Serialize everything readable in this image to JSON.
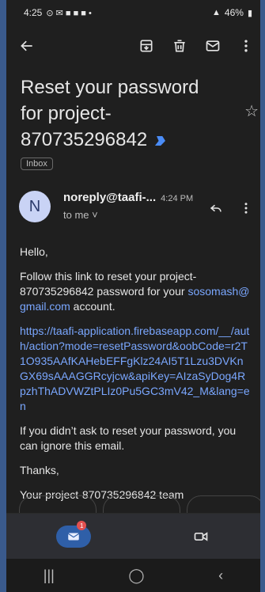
{
  "status_bar": {
    "time": "4:25",
    "left_glyphs": "⊙ ✉ ■ ■ ■ •",
    "battery": "46%"
  },
  "subject": {
    "title": "Reset your password for project-870735296842",
    "label": "Inbox"
  },
  "sender": {
    "avatar_letter": "N",
    "name": "noreply@taafi-...",
    "time": "4:24 PM",
    "recipient": "to me"
  },
  "body": {
    "greeting": "Hello,",
    "line1": "Follow this link to reset your project-870735296842 password for your",
    "email": "sosomash@gmail.com",
    "line1_suffix": " account.",
    "link": "https://taafi-application.firebaseapp.com/__/auth/action?mode=resetPassword&oobCode=r2T1O935AAfKAHebEFFgKlz24AI5T1Lzu3DVKnGX69sAAAGGRcyjcw&apiKey=AIzaSyDog4RpzhThADVWZtPLIz0Pu5GC3mV42_M&lang=en",
    "ignore": "If you didn’t ask to reset your password, you can ignore this email.",
    "thanks": "Thanks,",
    "signature": "Your project-870735296842 team"
  },
  "bottom_nav": {
    "mail_badge": "1"
  },
  "colors": {
    "link": "#7aa7ff",
    "background": "#1f1f1f",
    "accent": "#2f5fa8"
  }
}
